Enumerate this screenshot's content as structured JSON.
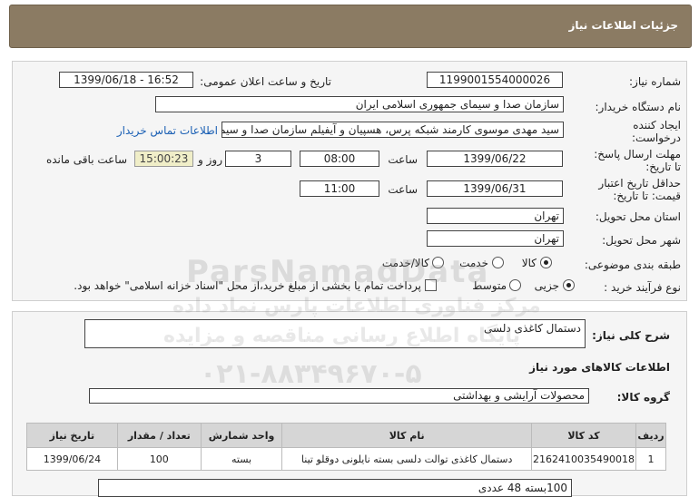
{
  "header": {
    "title": "جزئیات اطلاعات نیاز"
  },
  "form": {
    "need_number_label": "شماره نیاز:",
    "need_number": "1199001554000026",
    "announce_label": "تاریخ و ساعت اعلان عمومی:",
    "announce_value": "1399/06/18 - 16:52",
    "buyer_label": "نام دستگاه خریدار:",
    "buyer_value": "سازمان صدا و سیمای جمهوری اسلامی ایران",
    "creator_label_1": "ایجاد کننده",
    "creator_label_2": "درخواست:",
    "creator_value": "سید مهدی موسوی کارمند شبکه پرس، هسپیان و آیفیلم سازمان صدا و سیمای",
    "contact_link": "اطلاعات تماس خریدار",
    "deadline_label_1": "مهلت ارسال پاسخ:",
    "deadline_label_2": "تا تاریخ:",
    "deadline_date": "1399/06/22",
    "time_label": "ساعت",
    "deadline_time": "08:00",
    "days_value": "3",
    "days_label": "روز و",
    "remaining_time": "15:00:23",
    "remaining_label": "ساعت باقی مانده",
    "validity_label_1": "حداقل تاریخ اعتبار",
    "validity_label_2": "قیمت: تا تاریخ:",
    "validity_date": "1399/06/31",
    "validity_time": "11:00",
    "province_label": "استان محل تحویل:",
    "province_value": "تهران",
    "city_label": "شهر محل تحویل:",
    "city_value": "تهران",
    "category_label": "طبقه بندی موضوعی:",
    "category_options": [
      "کالا",
      "خدمت",
      "کالا/خدمت"
    ],
    "purchase_label": "نوع فرآیند خرید :",
    "purchase_options": [
      "جزیی",
      "متوسط"
    ],
    "payment_note": "پرداخت تمام یا بخشی از مبلغ خرید،از محل \"اسناد خزانه اسلامی\" خواهد بود."
  },
  "description": {
    "label": "شرح کلی نیاز:",
    "value": "دستمال کاغذی دلسی"
  },
  "goods": {
    "section_title": "اطلاعات کالاهای مورد نیاز",
    "group_label": "گروه کالا:",
    "group_value": "محصولات آرایشی و بهداشتی",
    "columns": [
      "ردیف",
      "کد کالا",
      "نام کالا",
      "واحد شمارش",
      "تعداد / مقدار",
      "تاریخ نیاز"
    ],
    "rows": [
      [
        "1",
        "2162410035490018",
        "دستمال کاغذی توالت دلسی بسته نایلونی دوقلو تینا",
        "بسته",
        "100",
        "1399/06/24"
      ]
    ],
    "note": "100بسته 48 عددی"
  },
  "watermark": {
    "brand": "ParsNamadData",
    "line1": "پایگاه اطلاع رسانی مناقصه و مزایده",
    "line2": "۰۲۱-۸۸۳۴۹۶۷۰-۵",
    "line3": "مرکز فناوری اطلاعات پارس نماد داده"
  }
}
